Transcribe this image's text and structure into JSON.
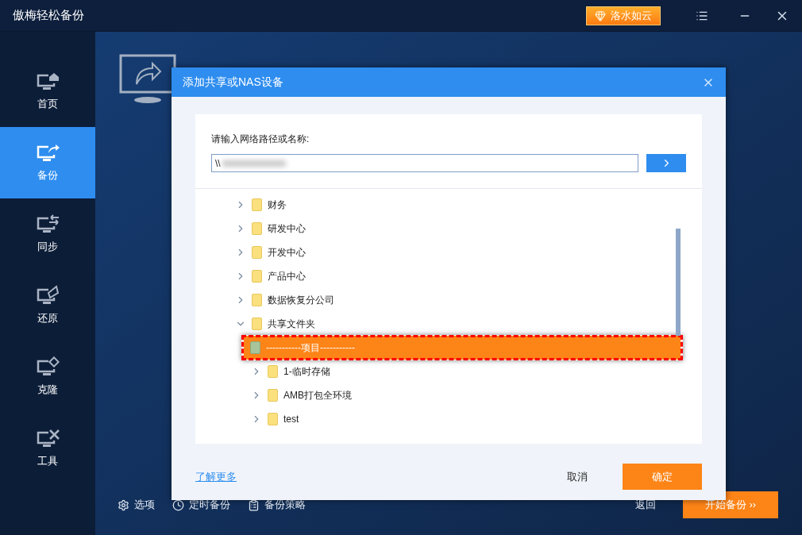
{
  "window": {
    "title": "傲梅轻松备份",
    "promo_button": "洛水如云"
  },
  "sidebar": {
    "items": [
      {
        "label": "首页",
        "selected": false
      },
      {
        "label": "备份",
        "selected": true
      },
      {
        "label": "同步",
        "selected": false
      },
      {
        "label": "还原",
        "selected": false
      },
      {
        "label": "克隆",
        "selected": false
      },
      {
        "label": "工具",
        "selected": false
      }
    ]
  },
  "dialog": {
    "title": "添加共享或NAS设备",
    "path_label": "请输入网络路径或名称:",
    "path_value": "\\\\",
    "tree": [
      {
        "label": "财务",
        "expanded": false,
        "selected": false
      },
      {
        "label": "研发中心",
        "expanded": false,
        "selected": false
      },
      {
        "label": "开发中心",
        "expanded": false,
        "selected": false
      },
      {
        "label": "产品中心",
        "expanded": false,
        "selected": false
      },
      {
        "label": "数据恢复分公司",
        "expanded": false,
        "selected": false
      },
      {
        "label": "共享文件夹",
        "expanded": true,
        "selected": false,
        "children": [
          {
            "label": "-----------项目-----------",
            "expanded": false,
            "selected": true
          },
          {
            "label": "1-临时存储",
            "expanded": false,
            "selected": false
          },
          {
            "label": "AMB打包全环境",
            "expanded": false,
            "selected": false
          },
          {
            "label": "test",
            "expanded": false,
            "selected": false
          }
        ]
      }
    ],
    "learn_more": "了解更多",
    "cancel": "取消",
    "ok": "确定"
  },
  "bottom_bar": {
    "items": [
      {
        "label": "选项"
      },
      {
        "label": "定时备份"
      },
      {
        "label": "备份策略"
      }
    ],
    "back": "返回",
    "start": "开始备份 ››"
  }
}
